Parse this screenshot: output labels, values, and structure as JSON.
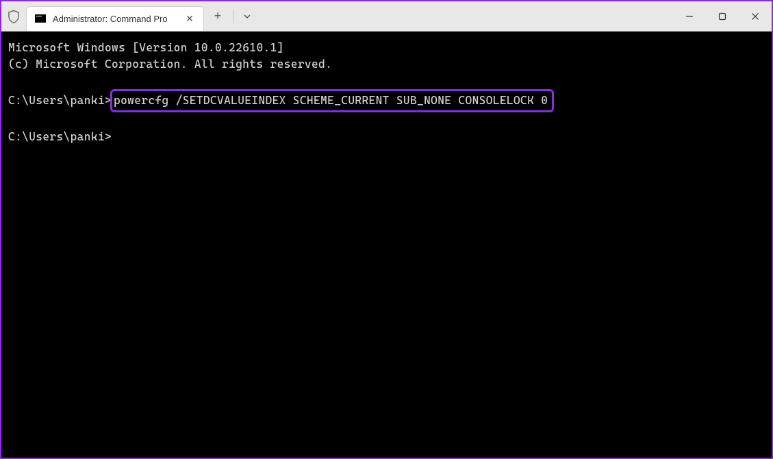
{
  "titlebar": {
    "tab_title": "Administrator: Command Pro"
  },
  "terminal": {
    "line1": "Microsoft Windows [Version 10.0.22610.1]",
    "line2": "(c) Microsoft Corporation. All rights reserved.",
    "prompt1": "C:\\Users\\panki>",
    "command": "powercfg /SETDCVALUEINDEX SCHEME_CURRENT SUB_NONE CONSOLELOCK 0",
    "prompt2": "C:\\Users\\panki>"
  }
}
